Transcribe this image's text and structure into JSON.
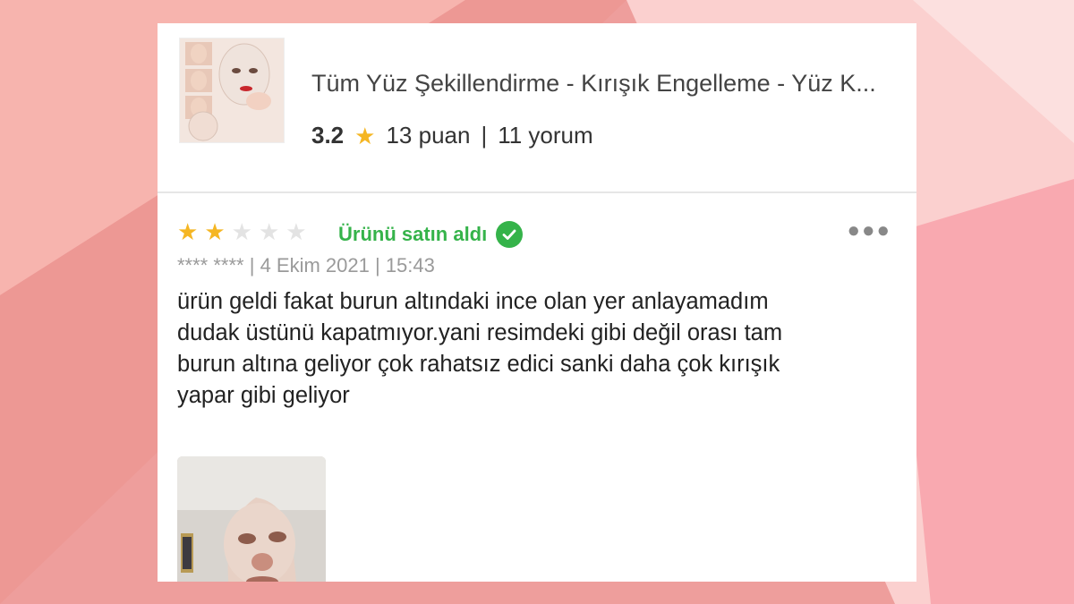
{
  "product": {
    "title": "Tüm Yüz Şekillendirme - Kırışık Engelleme - Yüz K...",
    "rating": "3.2",
    "rating_count": "13 puan",
    "separator": "|",
    "review_count": "11 yorum",
    "rating_star_icon": "star-icon"
  },
  "review": {
    "stars_filled": 2,
    "stars_total": 5,
    "verified_label": "Ürünü satın aldı",
    "author": "**** ****",
    "date": "4 Ekim 2021",
    "time": "15:43",
    "text_lines": [
      "ürün geldi fakat burun altındaki ince olan yer anlayamadım",
      "dudak üstünü kapatmıyor.yani resimdeki gibi değil orası tam",
      "burun altına geliyor çok rahatsız edici  sanki daha çok kırışık",
      "yapar gibi geliyor"
    ],
    "more_icon": "more-options-icon"
  },
  "colors": {
    "star_active": "#f5b623",
    "star_inactive": "#e3e3e3",
    "verified_green": "#35b34a",
    "background_pink": "#f4a7a7"
  }
}
